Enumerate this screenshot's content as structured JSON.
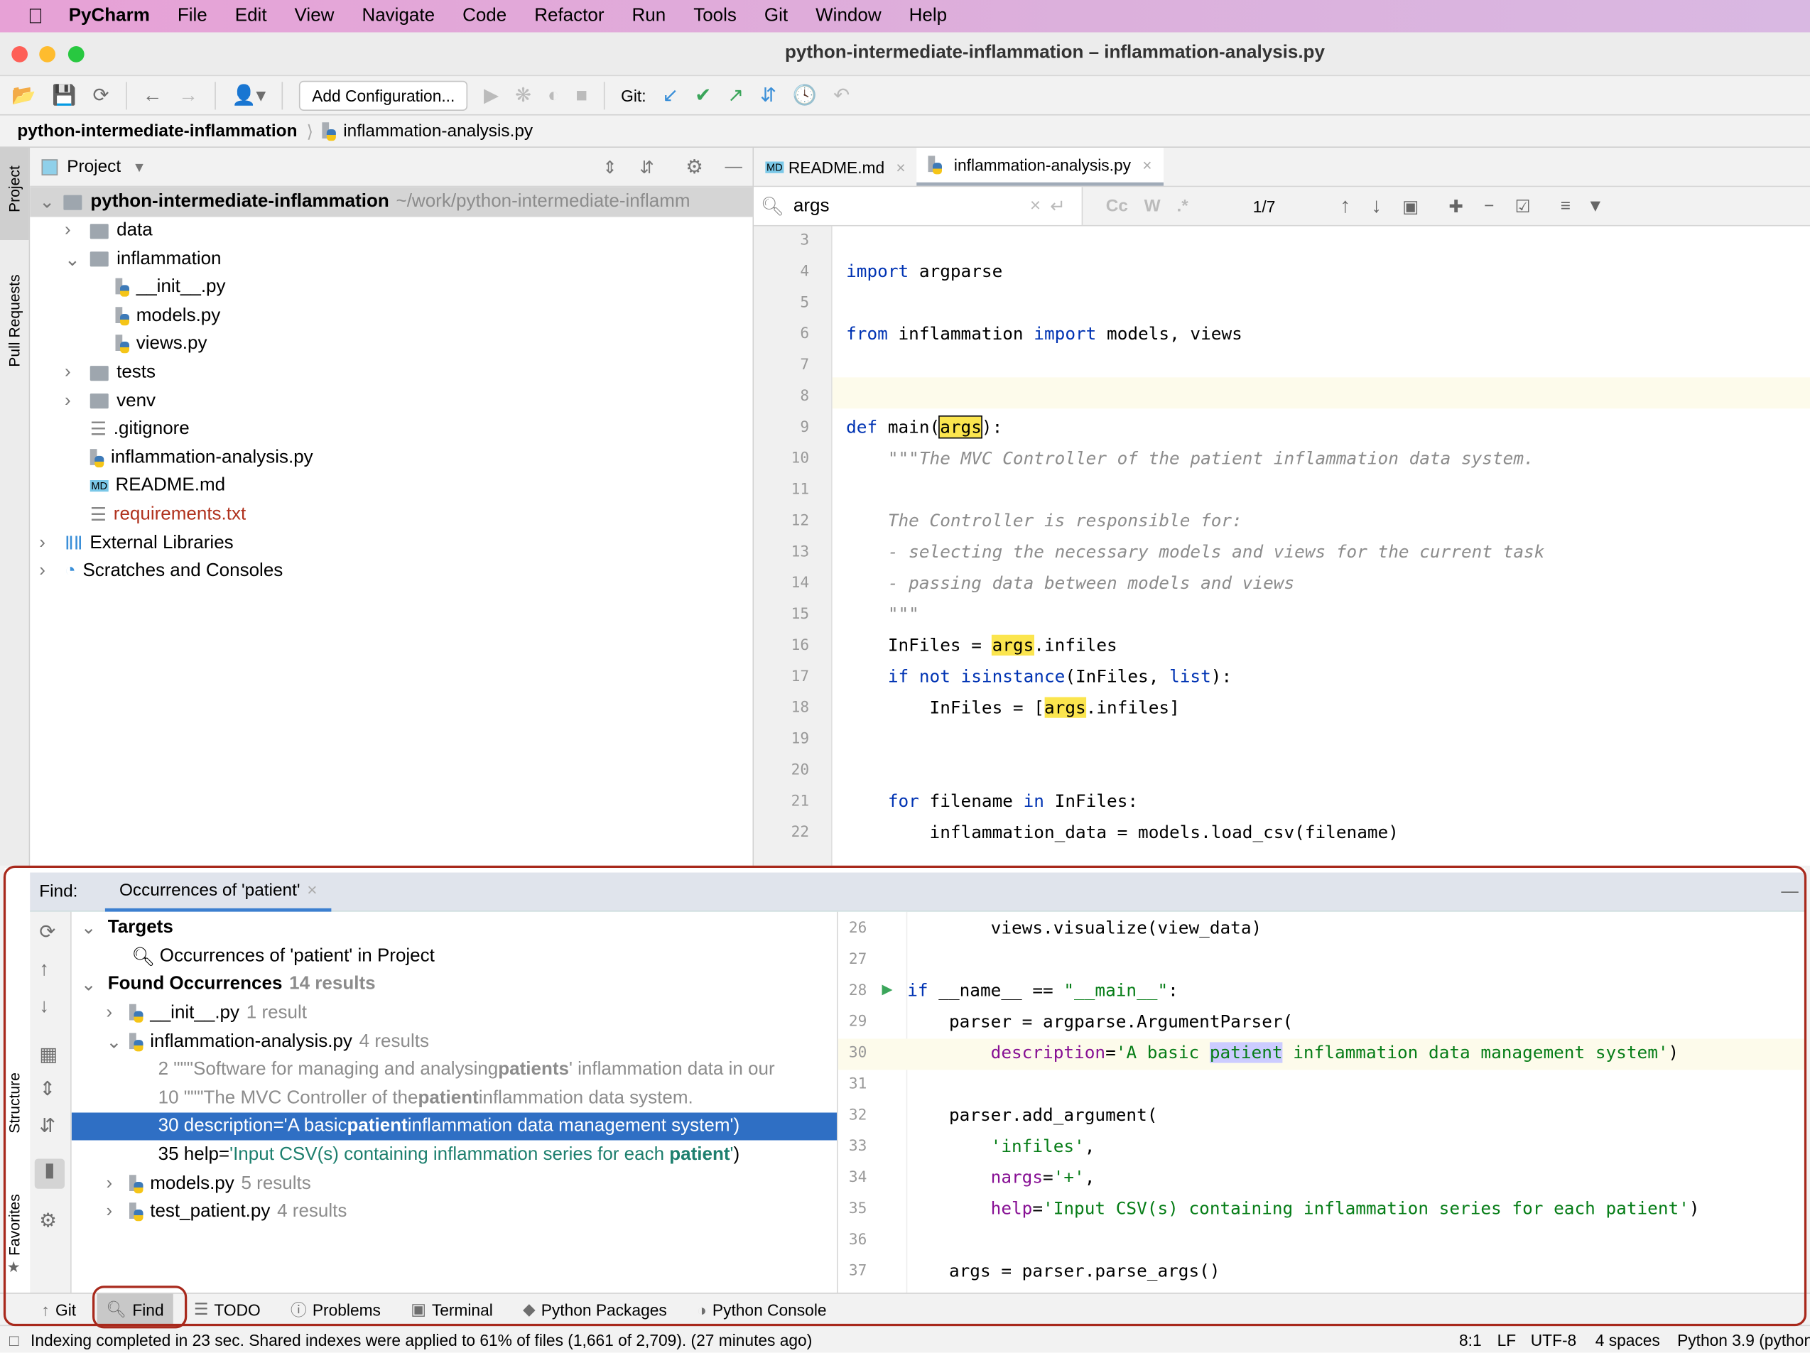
{
  "menubar": {
    "app": "PyCharm",
    "items": [
      "File",
      "Edit",
      "View",
      "Navigate",
      "Code",
      "Refactor",
      "Run",
      "Tools",
      "Git",
      "Window",
      "Help"
    ]
  },
  "window": {
    "title": "python-intermediate-inflammation – inflammation-analysis.py"
  },
  "toolbar": {
    "add_config": "Add Configuration...",
    "git_label": "Git:"
  },
  "breadcrumb": {
    "project": "python-intermediate-inflammation",
    "file": "inflammation-analysis.py"
  },
  "side_tabs": {
    "project": "Project",
    "pull_requests": "Pull Requests",
    "structure": "Structure",
    "favorites": "Favorites"
  },
  "project": {
    "header": "Project",
    "root": {
      "name": "python-intermediate-inflammation",
      "path": "~/work/python-intermediate-inflamm"
    },
    "items": [
      {
        "label": "data",
        "type": "folder",
        "expanded": false
      },
      {
        "label": "inflammation",
        "type": "folder",
        "expanded": true
      },
      {
        "label": "__init__.py",
        "type": "python"
      },
      {
        "label": "models.py",
        "type": "python"
      },
      {
        "label": "views.py",
        "type": "python"
      },
      {
        "label": "tests",
        "type": "folder",
        "expanded": false
      },
      {
        "label": "venv",
        "type": "folder",
        "expanded": false
      },
      {
        "label": ".gitignore",
        "type": "file"
      },
      {
        "label": "inflammation-analysis.py",
        "type": "python"
      },
      {
        "label": "README.md",
        "type": "markdown"
      },
      {
        "label": "requirements.txt",
        "type": "text",
        "color": "#b0321e"
      },
      {
        "label": "External Libraries",
        "type": "library"
      },
      {
        "label": "Scratches and Consoles",
        "type": "scratch"
      }
    ]
  },
  "editor": {
    "tabs": [
      {
        "label": "README.md",
        "active": false
      },
      {
        "label": "inflammation-analysis.py",
        "active": true
      }
    ],
    "search": {
      "value": "args",
      "match_count": "1/7",
      "opt_case": "Cc",
      "opt_words": "W",
      "opt_regex": ".*"
    },
    "lines": [
      {
        "n": "3",
        "tokens": []
      },
      {
        "n": "4",
        "tokens": [
          {
            "t": "import",
            "c": "kw"
          },
          {
            "t": " argparse",
            "c": "plain"
          }
        ]
      },
      {
        "n": "5",
        "tokens": []
      },
      {
        "n": "6",
        "tokens": [
          {
            "t": "from",
            "c": "kw"
          },
          {
            "t": " inflammation ",
            "c": "plain"
          },
          {
            "t": "import",
            "c": "kw"
          },
          {
            "t": " models, views",
            "c": "plain"
          }
        ]
      },
      {
        "n": "7",
        "tokens": []
      },
      {
        "n": "8",
        "tokens": []
      },
      {
        "n": "9",
        "tokens": [
          {
            "t": "def",
            "c": "kw"
          },
          {
            "t": " main(",
            "c": "plain"
          },
          {
            "t": "args",
            "c": "hlb"
          },
          {
            "t": "):",
            "c": "plain"
          }
        ]
      },
      {
        "n": "10",
        "tokens": [
          {
            "t": "    \"\"\"The MVC Controller of the patient inflammation data system.",
            "c": "cm"
          }
        ]
      },
      {
        "n": "11",
        "tokens": []
      },
      {
        "n": "12",
        "tokens": [
          {
            "t": "    The Controller is responsible for:",
            "c": "cm"
          }
        ]
      },
      {
        "n": "13",
        "tokens": [
          {
            "t": "    - selecting the necessary models and views for the current task",
            "c": "cm"
          }
        ]
      },
      {
        "n": "14",
        "tokens": [
          {
            "t": "    - passing data between models and views",
            "c": "cm"
          }
        ]
      },
      {
        "n": "15",
        "tokens": [
          {
            "t": "    \"\"\"",
            "c": "cm"
          }
        ]
      },
      {
        "n": "16",
        "tokens": [
          {
            "t": "    InFiles = ",
            "c": "plain"
          },
          {
            "t": "args",
            "c": "hl"
          },
          {
            "t": ".infiles",
            "c": "plain"
          }
        ]
      },
      {
        "n": "17",
        "tokens": [
          {
            "t": "    ",
            "c": "plain"
          },
          {
            "t": "if not isinstance",
            "c": "kw"
          },
          {
            "t": "(InFiles, ",
            "c": "plain"
          },
          {
            "t": "list",
            "c": "bi"
          },
          {
            "t": "):",
            "c": "plain"
          }
        ]
      },
      {
        "n": "18",
        "tokens": [
          {
            "t": "        InFiles = [",
            "c": "plain"
          },
          {
            "t": "args",
            "c": "hl"
          },
          {
            "t": ".infiles]",
            "c": "plain"
          }
        ]
      },
      {
        "n": "19",
        "tokens": []
      },
      {
        "n": "20",
        "tokens": []
      },
      {
        "n": "21",
        "tokens": [
          {
            "t": "    ",
            "c": "plain"
          },
          {
            "t": "for",
            "c": "kw"
          },
          {
            "t": " filename ",
            "c": "plain"
          },
          {
            "t": "in",
            "c": "kw"
          },
          {
            "t": " InFiles:",
            "c": "plain"
          }
        ]
      },
      {
        "n": "22",
        "tokens": [
          {
            "t": "        inflammation_data = models.load_csv(filename)",
            "c": "plain"
          }
        ]
      }
    ]
  },
  "find": {
    "label": "Find:",
    "tab": "Occurrences of 'patient'",
    "targets_label": "Targets",
    "target": "Occurrences of 'patient' in Project",
    "found_label": "Found Occurrences",
    "found_count": "14 results",
    "files": [
      {
        "name": "__init__.py",
        "count": "1 result",
        "expanded": false
      },
      {
        "name": "inflammation-analysis.py",
        "count": "4 results",
        "expanded": true
      },
      {
        "name": "models.py",
        "count": "5 results",
        "expanded": false
      },
      {
        "name": "test_patient.py",
        "count": "4 results",
        "expanded": false
      }
    ],
    "occurrences": [
      {
        "pre": "2 \"\"\"Software for managing and analysing ",
        "match": "patients",
        "post": "' inflammation data in our"
      },
      {
        "pre": "10 \"\"\"The MVC Controller of the ",
        "match": "patient",
        "post": " inflammation data system."
      },
      {
        "pre": "30 description='A basic ",
        "match": "patient",
        "post": " inflammation data management system')",
        "selected": true
      },
      {
        "pre": "35 help=",
        "str": "'Input CSV(s) containing inflammation series for each ",
        "match": "patient",
        "post2": "'",
        "post": ")"
      }
    ],
    "preview": [
      {
        "n": "26",
        "tokens": [
          {
            "t": "        views.visualize(view_data)",
            "c": "plain"
          }
        ]
      },
      {
        "n": "27",
        "tokens": []
      },
      {
        "n": "28",
        "tokens": [
          {
            "t": "if",
            "c": "kw"
          },
          {
            "t": " __name__ == ",
            "c": "plain"
          },
          {
            "t": "\"__main__\"",
            "c": "str"
          },
          {
            "t": ":",
            "c": "plain"
          }
        ]
      },
      {
        "n": "29",
        "tokens": [
          {
            "t": "    parser = argparse.ArgumentParser(",
            "c": "plain"
          }
        ]
      },
      {
        "n": "30",
        "tokens": [
          {
            "t": "        ",
            "c": "plain"
          },
          {
            "t": "description",
            "c": "param"
          },
          {
            "t": "=",
            "c": "plain"
          },
          {
            "t": "'A basic ",
            "c": "str"
          },
          {
            "t": "patient",
            "c": "pat"
          },
          {
            "t": " inflammation data management system'",
            "c": "str"
          },
          {
            "t": ")",
            "c": "plain"
          }
        ]
      },
      {
        "n": "31",
        "tokens": []
      },
      {
        "n": "32",
        "tokens": [
          {
            "t": "    parser.add_argument(",
            "c": "plain"
          }
        ]
      },
      {
        "n": "33",
        "tokens": [
          {
            "t": "        ",
            "c": "plain"
          },
          {
            "t": "'infiles'",
            "c": "str"
          },
          {
            "t": ",",
            "c": "plain"
          }
        ]
      },
      {
        "n": "34",
        "tokens": [
          {
            "t": "        ",
            "c": "plain"
          },
          {
            "t": "nargs",
            "c": "param"
          },
          {
            "t": "=",
            "c": "plain"
          },
          {
            "t": "'+'",
            "c": "str"
          },
          {
            "t": ",",
            "c": "plain"
          }
        ]
      },
      {
        "n": "35",
        "tokens": [
          {
            "t": "        ",
            "c": "plain"
          },
          {
            "t": "help",
            "c": "param"
          },
          {
            "t": "=",
            "c": "plain"
          },
          {
            "t": "'Input CSV(s) containing inflammation series for each patient'",
            "c": "str"
          },
          {
            "t": ")",
            "c": "plain"
          }
        ]
      },
      {
        "n": "36",
        "tokens": []
      },
      {
        "n": "37",
        "tokens": [
          {
            "t": "    args = parser.parse_args()",
            "c": "plain"
          }
        ]
      }
    ]
  },
  "bottom_tools": [
    {
      "label": "Git",
      "icon": "git-icon"
    },
    {
      "label": "Find",
      "icon": "search-icon",
      "active": true
    },
    {
      "label": "TODO",
      "icon": "list-icon"
    },
    {
      "label": "Problems",
      "icon": "problems-icon"
    },
    {
      "label": "Terminal",
      "icon": "terminal-icon"
    },
    {
      "label": "Python Packages",
      "icon": "packages-icon"
    },
    {
      "label": "Python Console",
      "icon": "python-console-icon"
    }
  ],
  "status": {
    "message": "Indexing completed in 23 sec. Shared indexes were applied to 61% of files (1,661 of 2,709). (27 minutes ago)",
    "position": "8:1",
    "line_sep": "LF",
    "encoding": "UTF-8",
    "indent": "4 spaces",
    "interpreter": "Python 3.9 (python"
  },
  "colors": {
    "selection": "#2f6fc4",
    "annotation": "#a8291c",
    "highlight": "#fbe54e"
  }
}
